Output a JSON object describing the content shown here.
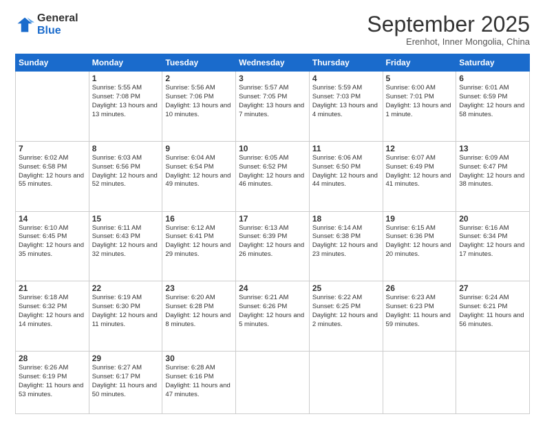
{
  "logo": {
    "general": "General",
    "blue": "Blue"
  },
  "header": {
    "month_title": "September 2025",
    "subtitle": "Erenhot, Inner Mongolia, China"
  },
  "weekdays": [
    "Sunday",
    "Monday",
    "Tuesday",
    "Wednesday",
    "Thursday",
    "Friday",
    "Saturday"
  ],
  "weeks": [
    [
      {
        "day": "",
        "sunrise": "",
        "sunset": "",
        "daylight": ""
      },
      {
        "day": "1",
        "sunrise": "Sunrise: 5:55 AM",
        "sunset": "Sunset: 7:08 PM",
        "daylight": "Daylight: 13 hours and 13 minutes."
      },
      {
        "day": "2",
        "sunrise": "Sunrise: 5:56 AM",
        "sunset": "Sunset: 7:06 PM",
        "daylight": "Daylight: 13 hours and 10 minutes."
      },
      {
        "day": "3",
        "sunrise": "Sunrise: 5:57 AM",
        "sunset": "Sunset: 7:05 PM",
        "daylight": "Daylight: 13 hours and 7 minutes."
      },
      {
        "day": "4",
        "sunrise": "Sunrise: 5:59 AM",
        "sunset": "Sunset: 7:03 PM",
        "daylight": "Daylight: 13 hours and 4 minutes."
      },
      {
        "day": "5",
        "sunrise": "Sunrise: 6:00 AM",
        "sunset": "Sunset: 7:01 PM",
        "daylight": "Daylight: 13 hours and 1 minute."
      },
      {
        "day": "6",
        "sunrise": "Sunrise: 6:01 AM",
        "sunset": "Sunset: 6:59 PM",
        "daylight": "Daylight: 12 hours and 58 minutes."
      }
    ],
    [
      {
        "day": "7",
        "sunrise": "Sunrise: 6:02 AM",
        "sunset": "Sunset: 6:58 PM",
        "daylight": "Daylight: 12 hours and 55 minutes."
      },
      {
        "day": "8",
        "sunrise": "Sunrise: 6:03 AM",
        "sunset": "Sunset: 6:56 PM",
        "daylight": "Daylight: 12 hours and 52 minutes."
      },
      {
        "day": "9",
        "sunrise": "Sunrise: 6:04 AM",
        "sunset": "Sunset: 6:54 PM",
        "daylight": "Daylight: 12 hours and 49 minutes."
      },
      {
        "day": "10",
        "sunrise": "Sunrise: 6:05 AM",
        "sunset": "Sunset: 6:52 PM",
        "daylight": "Daylight: 12 hours and 46 minutes."
      },
      {
        "day": "11",
        "sunrise": "Sunrise: 6:06 AM",
        "sunset": "Sunset: 6:50 PM",
        "daylight": "Daylight: 12 hours and 44 minutes."
      },
      {
        "day": "12",
        "sunrise": "Sunrise: 6:07 AM",
        "sunset": "Sunset: 6:49 PM",
        "daylight": "Daylight: 12 hours and 41 minutes."
      },
      {
        "day": "13",
        "sunrise": "Sunrise: 6:09 AM",
        "sunset": "Sunset: 6:47 PM",
        "daylight": "Daylight: 12 hours and 38 minutes."
      }
    ],
    [
      {
        "day": "14",
        "sunrise": "Sunrise: 6:10 AM",
        "sunset": "Sunset: 6:45 PM",
        "daylight": "Daylight: 12 hours and 35 minutes."
      },
      {
        "day": "15",
        "sunrise": "Sunrise: 6:11 AM",
        "sunset": "Sunset: 6:43 PM",
        "daylight": "Daylight: 12 hours and 32 minutes."
      },
      {
        "day": "16",
        "sunrise": "Sunrise: 6:12 AM",
        "sunset": "Sunset: 6:41 PM",
        "daylight": "Daylight: 12 hours and 29 minutes."
      },
      {
        "day": "17",
        "sunrise": "Sunrise: 6:13 AM",
        "sunset": "Sunset: 6:39 PM",
        "daylight": "Daylight: 12 hours and 26 minutes."
      },
      {
        "day": "18",
        "sunrise": "Sunrise: 6:14 AM",
        "sunset": "Sunset: 6:38 PM",
        "daylight": "Daylight: 12 hours and 23 minutes."
      },
      {
        "day": "19",
        "sunrise": "Sunrise: 6:15 AM",
        "sunset": "Sunset: 6:36 PM",
        "daylight": "Daylight: 12 hours and 20 minutes."
      },
      {
        "day": "20",
        "sunrise": "Sunrise: 6:16 AM",
        "sunset": "Sunset: 6:34 PM",
        "daylight": "Daylight: 12 hours and 17 minutes."
      }
    ],
    [
      {
        "day": "21",
        "sunrise": "Sunrise: 6:18 AM",
        "sunset": "Sunset: 6:32 PM",
        "daylight": "Daylight: 12 hours and 14 minutes."
      },
      {
        "day": "22",
        "sunrise": "Sunrise: 6:19 AM",
        "sunset": "Sunset: 6:30 PM",
        "daylight": "Daylight: 12 hours and 11 minutes."
      },
      {
        "day": "23",
        "sunrise": "Sunrise: 6:20 AM",
        "sunset": "Sunset: 6:28 PM",
        "daylight": "Daylight: 12 hours and 8 minutes."
      },
      {
        "day": "24",
        "sunrise": "Sunrise: 6:21 AM",
        "sunset": "Sunset: 6:26 PM",
        "daylight": "Daylight: 12 hours and 5 minutes."
      },
      {
        "day": "25",
        "sunrise": "Sunrise: 6:22 AM",
        "sunset": "Sunset: 6:25 PM",
        "daylight": "Daylight: 12 hours and 2 minutes."
      },
      {
        "day": "26",
        "sunrise": "Sunrise: 6:23 AM",
        "sunset": "Sunset: 6:23 PM",
        "daylight": "Daylight: 11 hours and 59 minutes."
      },
      {
        "day": "27",
        "sunrise": "Sunrise: 6:24 AM",
        "sunset": "Sunset: 6:21 PM",
        "daylight": "Daylight: 11 hours and 56 minutes."
      }
    ],
    [
      {
        "day": "28",
        "sunrise": "Sunrise: 6:26 AM",
        "sunset": "Sunset: 6:19 PM",
        "daylight": "Daylight: 11 hours and 53 minutes."
      },
      {
        "day": "29",
        "sunrise": "Sunrise: 6:27 AM",
        "sunset": "Sunset: 6:17 PM",
        "daylight": "Daylight: 11 hours and 50 minutes."
      },
      {
        "day": "30",
        "sunrise": "Sunrise: 6:28 AM",
        "sunset": "Sunset: 6:16 PM",
        "daylight": "Daylight: 11 hours and 47 minutes."
      },
      {
        "day": "",
        "sunrise": "",
        "sunset": "",
        "daylight": ""
      },
      {
        "day": "",
        "sunrise": "",
        "sunset": "",
        "daylight": ""
      },
      {
        "day": "",
        "sunrise": "",
        "sunset": "",
        "daylight": ""
      },
      {
        "day": "",
        "sunrise": "",
        "sunset": "",
        "daylight": ""
      }
    ]
  ]
}
